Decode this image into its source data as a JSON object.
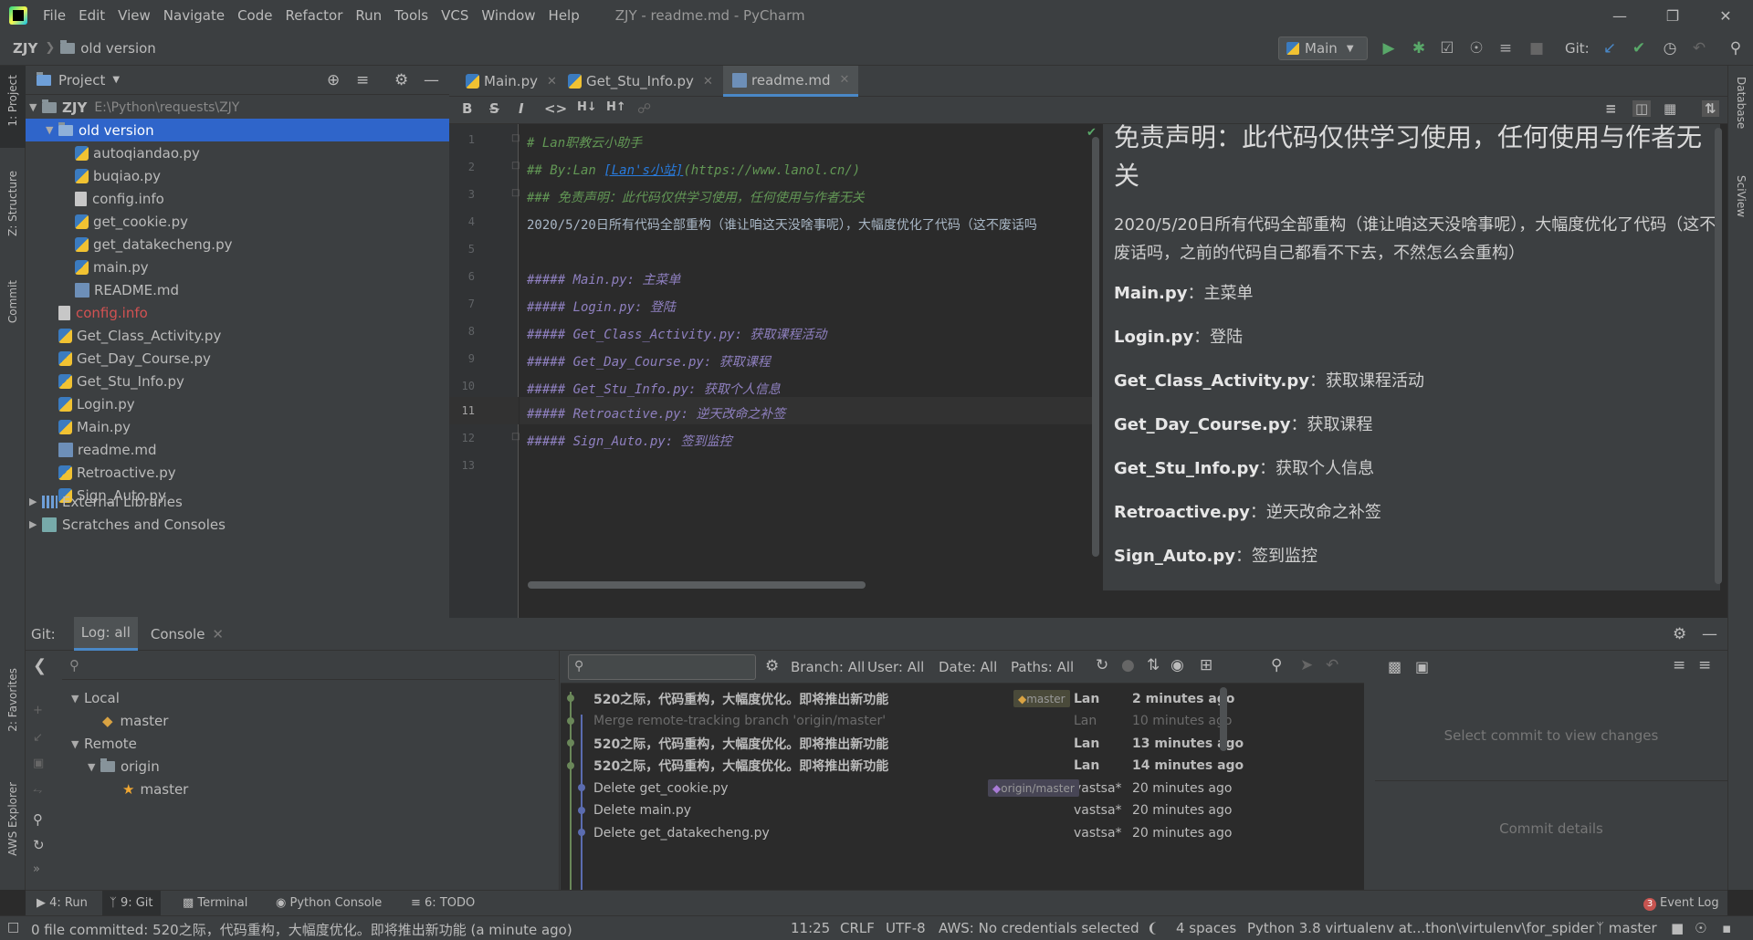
{
  "app": {
    "window_title": "ZJY - readme.md - PyCharm"
  },
  "menu": [
    "File",
    "Edit",
    "View",
    "Navigate",
    "Code",
    "Refactor",
    "Run",
    "Tools",
    "VCS",
    "Window",
    "Help"
  ],
  "breadcrumb": {
    "root": "ZJY",
    "folder": "old version"
  },
  "toolbar": {
    "run_config": "Main",
    "git_label": "Git:"
  },
  "left_strip": {
    "project": "1: Project",
    "structure": "Z: Structure",
    "commit": "Commit",
    "favorites": "2: Favorites",
    "aws": "AWS Explorer"
  },
  "right_strip": {
    "database": "Database",
    "sciview": "SciView"
  },
  "project": {
    "title": "Project",
    "root_name": "ZJY",
    "root_path": "E:\\Python\\requests\\ZJY",
    "items": [
      {
        "label": "old version",
        "type": "folder",
        "indent": 1,
        "expanded": true
      },
      {
        "label": "autoqiandao.py",
        "type": "py",
        "indent": 2
      },
      {
        "label": "buqiao.py",
        "type": "py",
        "indent": 2
      },
      {
        "label": "config.info",
        "type": "cfg",
        "indent": 2
      },
      {
        "label": "get_cookie.py",
        "type": "py",
        "indent": 2
      },
      {
        "label": "get_datakecheng.py",
        "type": "py",
        "indent": 2
      },
      {
        "label": "main.py",
        "type": "py",
        "indent": 2
      },
      {
        "label": "README.md",
        "type": "md",
        "indent": 2
      },
      {
        "label": "config.info",
        "type": "cfg-red",
        "indent": 1
      },
      {
        "label": "Get_Class_Activity.py",
        "type": "py",
        "indent": 1
      },
      {
        "label": "Get_Day_Course.py",
        "type": "py",
        "indent": 1
      },
      {
        "label": "Get_Stu_Info.py",
        "type": "py",
        "indent": 1
      },
      {
        "label": "Login.py",
        "type": "py",
        "indent": 1
      },
      {
        "label": "Main.py",
        "type": "py",
        "indent": 1
      },
      {
        "label": "readme.md",
        "type": "md",
        "indent": 1
      },
      {
        "label": "Retroactive.py",
        "type": "py",
        "indent": 1
      },
      {
        "label": "Sign_Auto.py",
        "type": "py",
        "indent": 1
      }
    ],
    "external": "External Libraries",
    "scratches": "Scratches and Consoles"
  },
  "tabs": [
    {
      "label": "Main.py"
    },
    {
      "label": "Get_Stu_Info.py"
    },
    {
      "label": "readme.md"
    }
  ],
  "code": {
    "lines": [
      "1",
      "2",
      "3",
      "4",
      "5",
      "6",
      "7",
      "8",
      "9",
      "10",
      "11",
      "12",
      "13"
    ],
    "l1": "# Lan职教云小助手",
    "l2a": "## By:Lan ",
    "l2b": "[Lan's小站]",
    "l2c": "(https://www.lanol.cn/)",
    "l3": "### 免责声明：此代码仅供学习使用，任何使用与作者无关",
    "l4": "2020/5/20日所有代码全部重构（谁让咱这天没啥事呢），大幅度优化了代码（这不废话吗",
    "l6": "##### Main.py: 主菜单",
    "l7": "##### Login.py: 登陆",
    "l8": "##### Get_Class_Activity.py: 获取课程活动",
    "l9": "##### Get_Day_Course.py: 获取课程",
    "l10": "##### Get_Stu_Info.py: 获取个人信息",
    "l11": "##### Retroactive.py: 逆天改命之补签",
    "l12": "##### Sign_Auto.py: 签到监控"
  },
  "preview": {
    "h1": "免责声明：此代码仅供学习使用，任何使用与作者无关",
    "p1": "2020/5/20日所有代码全部重构（谁让咱这天没啥事呢），大幅度优化了代码（这不废话吗，之前的代码自己都看不下去，不然怎么会重构）",
    "items": [
      {
        "name": "Main.py",
        "desc": "：主菜单"
      },
      {
        "name": "Login.py",
        "desc": "：登陆"
      },
      {
        "name": "Get_Class_Activity.py",
        "desc": "：获取课程活动"
      },
      {
        "name": "Get_Day_Course.py",
        "desc": "：获取课程"
      },
      {
        "name": "Get_Stu_Info.py",
        "desc": "：获取个人信息"
      },
      {
        "name": "Retroactive.py",
        "desc": "：逆天改命之补签"
      },
      {
        "name": "Sign_Auto.py",
        "desc": "：签到监控"
      }
    ]
  },
  "git": {
    "label": "Git:",
    "tab_log": "Log: all",
    "tab_console": "Console",
    "local": "Local",
    "local_master": "master",
    "remote": "Remote",
    "origin": "origin",
    "origin_master": "master",
    "filters": {
      "branch": "Branch: All",
      "user": "User: All",
      "date": "Date: All",
      "paths": "Paths: All"
    },
    "commits": [
      {
        "msg": "520之际，代码重构，大幅度优化。即将推出新功能",
        "author": "Lan",
        "time": "2 minutes ago",
        "bold": true,
        "tag": "master"
      },
      {
        "msg": "Merge remote-tracking branch 'origin/master'",
        "author": "Lan",
        "time": "10 minutes ago",
        "dim": true
      },
      {
        "msg": "520之际，代码重构，大幅度优化。即将推出新功能",
        "author": "Lan",
        "time": "13 minutes ago",
        "bold": true
      },
      {
        "msg": "520之际，代码重构，大幅度优化。即将推出新功能",
        "author": "Lan",
        "time": "14 minutes ago",
        "bold": true
      },
      {
        "msg": "Delete get_cookie.py",
        "author": "vastsa*",
        "time": "20 minutes ago",
        "tag": "origin/master"
      },
      {
        "msg": "Delete main.py",
        "author": "vastsa*",
        "time": "20 minutes ago"
      },
      {
        "msg": "Delete get_datakecheng.py",
        "author": "vastsa*",
        "time": "20 minutes ago"
      }
    ],
    "select_commit": "Select commit to view changes",
    "commit_details": "Commit details"
  },
  "toolwindows": [
    "4: Run",
    "9: Git",
    "Terminal",
    "Python Console",
    "6: TODO"
  ],
  "event_log": "Event Log",
  "event_count": "3",
  "status": {
    "message": "0 file committed: 520之际，代码重构，大幅度优化。即将推出新功能 (a minute ago)",
    "position": "11:25",
    "line_sep": "CRLF",
    "encoding": "UTF-8",
    "aws": "AWS: No credentials selected",
    "indent": "4 spaces",
    "interpreter": "Python 3.8 virtualenv at...thon\\virtulenv\\for_spider",
    "branch": "master"
  }
}
